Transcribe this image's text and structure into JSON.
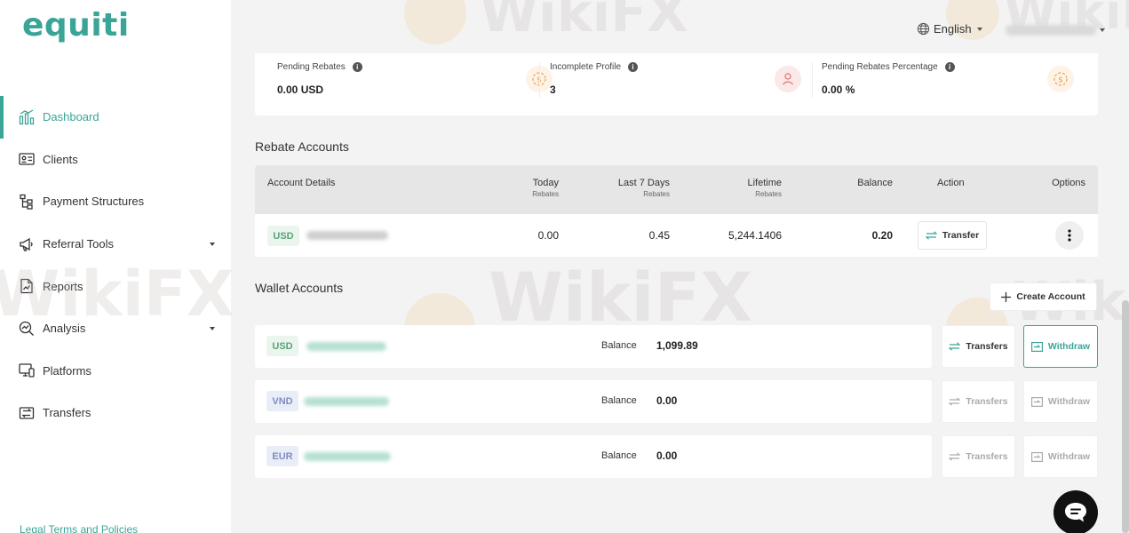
{
  "brand": {
    "logo_text": "equiti",
    "accent": "#3aa597"
  },
  "sidebar": {
    "items": [
      {
        "label": "Dashboard",
        "icon": "dashboard-icon",
        "active": true
      },
      {
        "label": "Clients",
        "icon": "clients-icon"
      },
      {
        "label": "Payment Structures",
        "icon": "payment-structures-icon"
      },
      {
        "label": "Referral Tools",
        "icon": "megaphone-icon",
        "dropdown": true
      },
      {
        "label": "Reports",
        "icon": "report-icon"
      },
      {
        "label": "Analysis",
        "icon": "analysis-icon",
        "dropdown": true
      },
      {
        "label": "Platforms",
        "icon": "platforms-icon"
      },
      {
        "label": "Transfers",
        "icon": "transfers-icon"
      }
    ],
    "legal_link": "Legal Terms and Policies"
  },
  "topbar": {
    "language": "English"
  },
  "stats": [
    {
      "label": "Pending Rebates",
      "value": "0.00 USD",
      "icon": "rebate-coin-icon"
    },
    {
      "label": "Incomplete Profile",
      "value": "3",
      "icon": "user-icon"
    },
    {
      "label": "Pending Rebates Percentage",
      "value": "0.00 %",
      "icon": "rebate-coin-icon"
    }
  ],
  "rebate_accounts": {
    "title": "Rebate Accounts",
    "headers": {
      "account_details": "Account Details",
      "today": "Today",
      "today_sub": "Rebates",
      "last7": "Last 7 Days",
      "last7_sub": "Rebates",
      "lifetime": "Lifetime",
      "lifetime_sub": "Rebates",
      "balance": "Balance",
      "action": "Action",
      "options": "Options"
    },
    "rows": [
      {
        "currency": "USD",
        "today": "0.00",
        "last7": "0.45",
        "lifetime": "5,244.1406",
        "balance": "0.20",
        "action_label": "Transfer"
      }
    ]
  },
  "wallet_accounts": {
    "title": "Wallet Accounts",
    "create_label": "Create Account",
    "balance_label": "Balance",
    "transfers_label": "Transfers",
    "withdraw_label": "Withdraw",
    "rows": [
      {
        "currency": "USD",
        "balance": "1,099.89",
        "enabled": true,
        "currency_color": "green"
      },
      {
        "currency": "VND",
        "balance": "0.00",
        "enabled": false,
        "currency_color": "blue"
      },
      {
        "currency": "EUR",
        "balance": "0.00",
        "enabled": false,
        "currency_color": "blue"
      }
    ]
  },
  "watermark": "WikiFX"
}
